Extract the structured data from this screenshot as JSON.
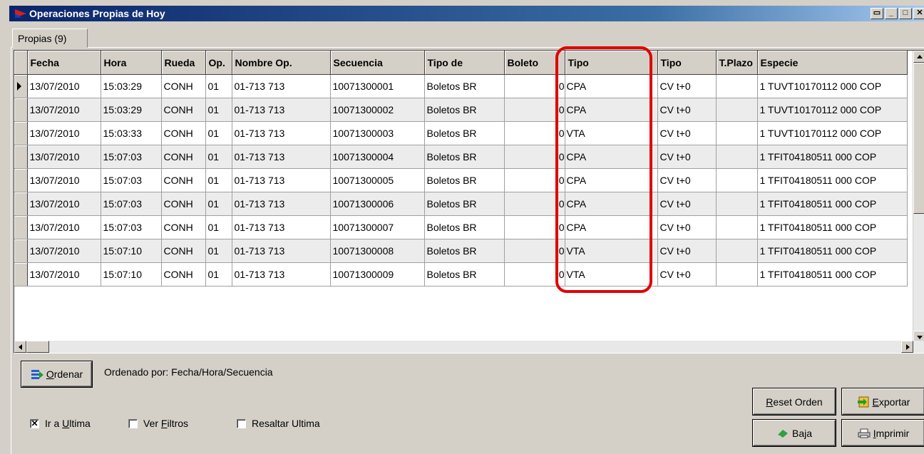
{
  "window": {
    "title": "Operaciones Propias de Hoy",
    "buttons": [
      "restore-icon",
      "minimize-icon",
      "maximize-icon",
      "close-icon"
    ]
  },
  "tab": {
    "label": "Propias (9)"
  },
  "grid": {
    "columns": [
      "Fecha",
      "Hora",
      "Rueda",
      "Op.",
      "Nombre Op.",
      "Secuencia",
      "Tipo de",
      "Boleto",
      "Tipo",
      "Tipo",
      "T.Plazo",
      "Especie"
    ],
    "rows": [
      [
        "13/07/2010",
        "15:03:29",
        "CONH",
        "01",
        "01-713 713",
        "10071300001",
        "Boletos BR",
        "0",
        "CPA",
        "CV t+0",
        "",
        "1 TUVT10170112 000 COP"
      ],
      [
        "13/07/2010",
        "15:03:29",
        "CONH",
        "01",
        "01-713 713",
        "10071300002",
        "Boletos BR",
        "0",
        "CPA",
        "CV t+0",
        "",
        "1 TUVT10170112 000 COP"
      ],
      [
        "13/07/2010",
        "15:03:33",
        "CONH",
        "01",
        "01-713 713",
        "10071300003",
        "Boletos BR",
        "0",
        "VTA",
        "CV t+0",
        "",
        "1 TUVT10170112 000 COP"
      ],
      [
        "13/07/2010",
        "15:07:03",
        "CONH",
        "01",
        "01-713 713",
        "10071300004",
        "Boletos BR",
        "0",
        "CPA",
        "CV t+0",
        "",
        "1 TFIT04180511 000 COP"
      ],
      [
        "13/07/2010",
        "15:07:03",
        "CONH",
        "01",
        "01-713 713",
        "10071300005",
        "Boletos BR",
        "0",
        "CPA",
        "CV t+0",
        "",
        "1 TFIT04180511 000 COP"
      ],
      [
        "13/07/2010",
        "15:07:03",
        "CONH",
        "01",
        "01-713 713",
        "10071300006",
        "Boletos BR",
        "0",
        "CPA",
        "CV t+0",
        "",
        "1 TFIT04180511 000 COP"
      ],
      [
        "13/07/2010",
        "15:07:03",
        "CONH",
        "01",
        "01-713 713",
        "10071300007",
        "Boletos BR",
        "0",
        "CPA",
        "CV t+0",
        "",
        "1 TFIT04180511 000 COP"
      ],
      [
        "13/07/2010",
        "15:07:10",
        "CONH",
        "01",
        "01-713 713",
        "10071300008",
        "Boletos BR",
        "0",
        "VTA",
        "CV t+0",
        "",
        "1 TFIT04180511 000 COP"
      ],
      [
        "13/07/2010",
        "15:07:10",
        "CONH",
        "01",
        "01-713 713",
        "10071300009",
        "Boletos BR",
        "0",
        "VTA",
        "CV t+0",
        "",
        "1 TFIT04180511 000 COP"
      ]
    ]
  },
  "footer": {
    "ordenar_label": "Ordenar",
    "ordenado_text": "Ordenado por: Fecha/Hora/Secuencia",
    "ir_ultima_label": "Ir a Ultima",
    "ir_ultima_checked": true,
    "ver_filtros_label": "Ver Filtros",
    "resaltar_label": "Resaltar Ultima",
    "reset_label": "Reset Orden",
    "exportar_label": "Exportar",
    "baja_label": "Baja",
    "imprimir_label": "Imprimir"
  },
  "colors": {
    "highlight": "#e00000",
    "title_bar": "#0a246a"
  }
}
